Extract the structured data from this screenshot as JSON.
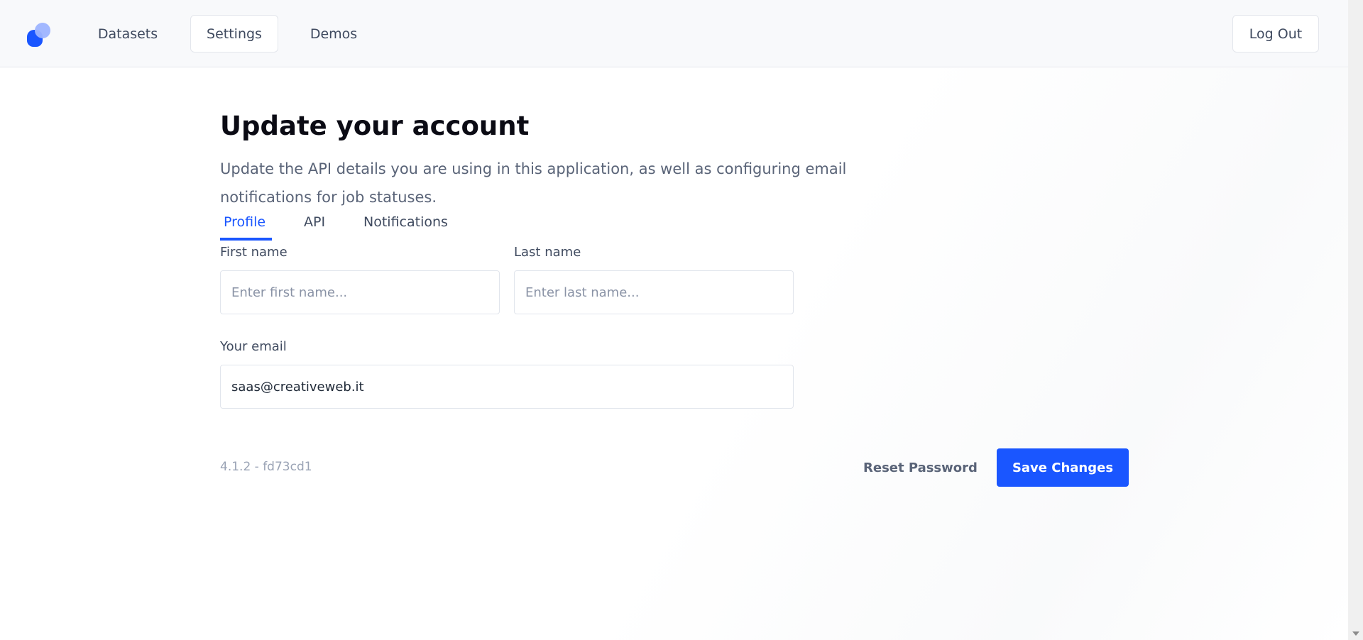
{
  "nav": {
    "items": [
      "Datasets",
      "Settings",
      "Demos"
    ],
    "logout": "Log Out"
  },
  "page": {
    "title": "Update your account",
    "subtitle": "Update the API details you are using in this application, as well as configuring email notifications for job statuses."
  },
  "tabs": [
    {
      "label": "Profile",
      "active": true
    },
    {
      "label": "API"
    },
    {
      "label": "Notifications"
    }
  ],
  "form": {
    "first_name": {
      "label": "First name",
      "placeholder": "Enter first name...",
      "value": ""
    },
    "last_name": {
      "label": "Last name",
      "placeholder": "Enter last name...",
      "value": ""
    },
    "email": {
      "label": "Your email",
      "value": "saas@creativeweb.it"
    }
  },
  "footer": {
    "version": "4.1.2 - fd73cd1",
    "reset": "Reset Password",
    "save": "Save Changes"
  },
  "colors": {
    "accent": "#1a56ff"
  }
}
